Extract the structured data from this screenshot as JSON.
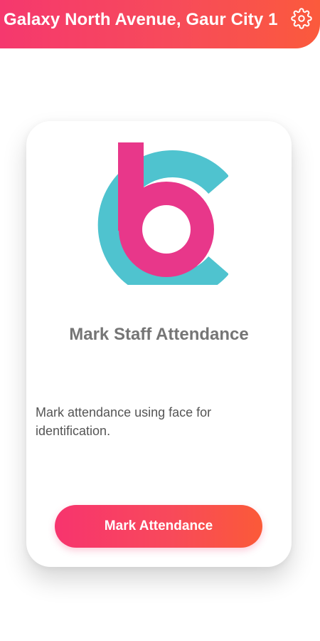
{
  "header": {
    "title": "Galaxy North Avenue, Gaur City 1",
    "settings_icon": "gear-icon"
  },
  "card": {
    "logo_icon": "bc-logo",
    "title": "Mark Staff Attendance",
    "description": "Mark attendance using face for identification.",
    "button_label": "Mark Attendance"
  },
  "colors": {
    "accent_start": "#f5386e",
    "accent_end": "#fb5a3c",
    "logo_teal": "#4fc3cf",
    "logo_pink": "#e8378a"
  }
}
